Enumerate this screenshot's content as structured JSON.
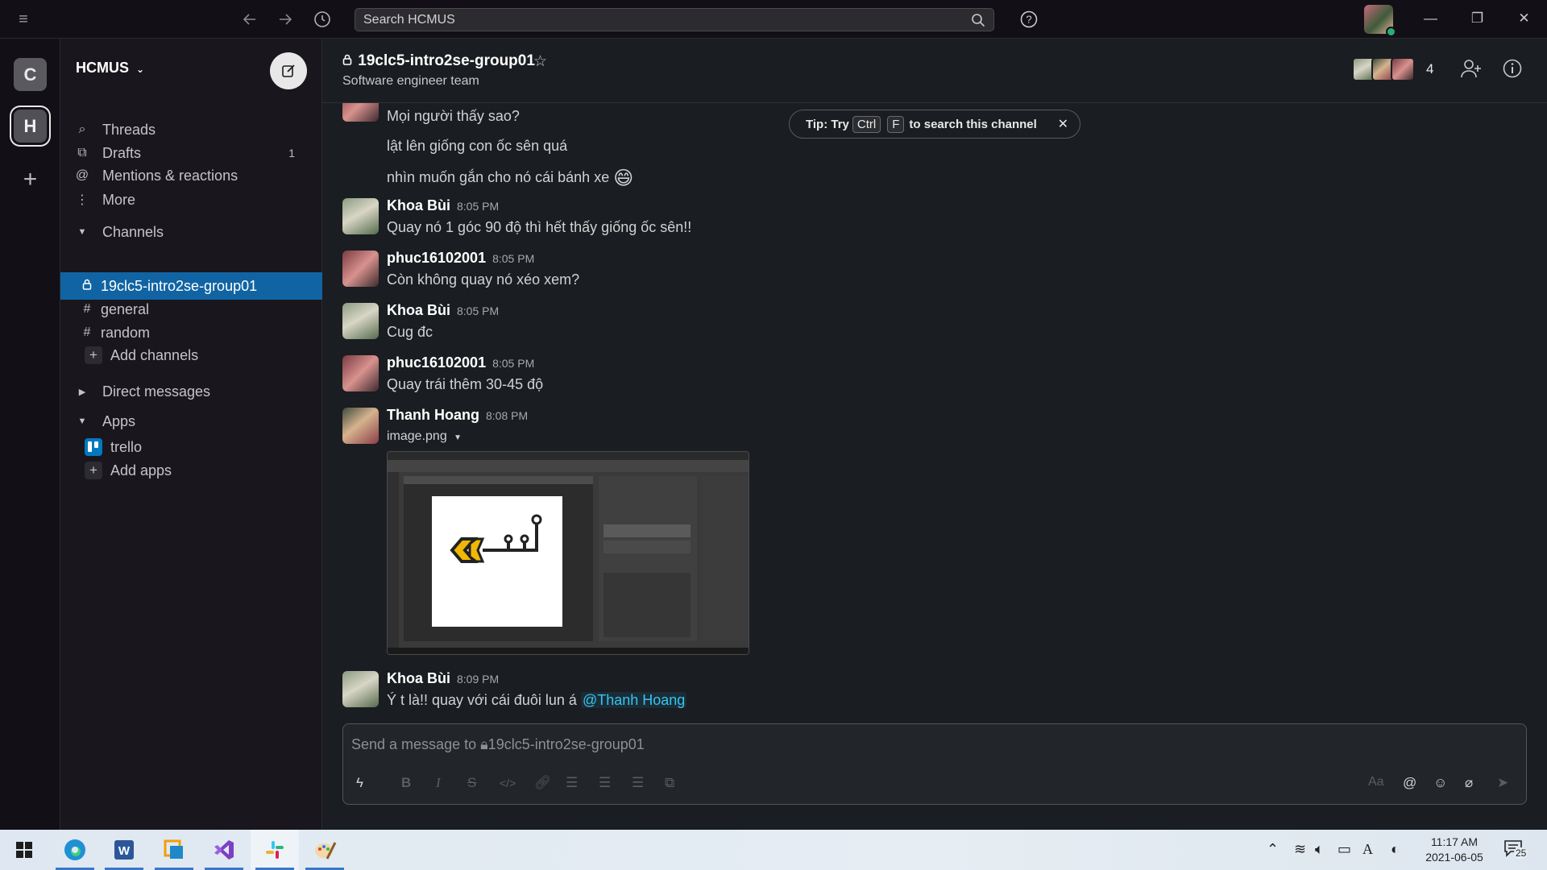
{
  "search": {
    "placeholder": "Search HCMUS"
  },
  "workspaces": [
    {
      "initial": "C"
    },
    {
      "initial": "H"
    }
  ],
  "sidebar": {
    "workspace_name": "HCMUS",
    "nav": [
      {
        "label": "Threads"
      },
      {
        "label": "Drafts",
        "count": "1"
      },
      {
        "label": "Mentions & reactions"
      },
      {
        "label": "More"
      }
    ],
    "channels_header": "Channels",
    "channels": [
      {
        "name": "19clc5-intro2se-group01",
        "private": true,
        "active": true
      },
      {
        "name": "general"
      },
      {
        "name": "random"
      }
    ],
    "add_channels": "Add channels",
    "direct_messages_header": "Direct messages",
    "apps_header": "Apps",
    "apps": [
      {
        "name": "trello"
      }
    ],
    "add_apps": "Add apps"
  },
  "channel": {
    "name": "19clc5-intro2se-group01",
    "topic": "Software engineer team",
    "member_count": "4"
  },
  "tip": {
    "prefix": "Tip: Try",
    "key1": "Ctrl",
    "key2": "F",
    "suffix": "to search this channel"
  },
  "messages": {
    "cont1": "Mọi người thấy sao?",
    "cont2": "lật lên giống con ốc sên quá",
    "cont3": "nhìn muốn gắn cho nó cái bánh xe",
    "m1": {
      "sender": "Khoa Bùi",
      "time": "8:05 PM",
      "text": "Quay nó 1 góc 90 độ thì hết thấy giống ốc sên!!"
    },
    "m2": {
      "sender": "phuc16102001",
      "time": "8:05 PM",
      "text": "Còn không quay nó xéo xem?"
    },
    "m3": {
      "sender": "Khoa Bùi",
      "time": "8:05 PM",
      "text": "Cug đc"
    },
    "m4": {
      "sender": "phuc16102001",
      "time": "8:05 PM",
      "text": "Quay trái thêm 30-45 độ"
    },
    "m5": {
      "sender": "Thanh Hoang",
      "time": "8:08 PM",
      "file": "image.png"
    },
    "m6": {
      "sender": "Khoa Bùi",
      "time": "8:09 PM",
      "text": "Ý t là!! quay với cái đuôi lun á",
      "mention": "@Thanh Hoang"
    }
  },
  "composer": {
    "placeholder": "Send a message to 🔒︎19clc5-intro2se-group01"
  },
  "taskbar": {
    "time": "11:17 AM",
    "date": "2021-06-05",
    "notifications": "25"
  },
  "colors": {
    "sidebar_active": "#1164a3",
    "online": "#2bac76",
    "mention": "#36c5f0"
  }
}
